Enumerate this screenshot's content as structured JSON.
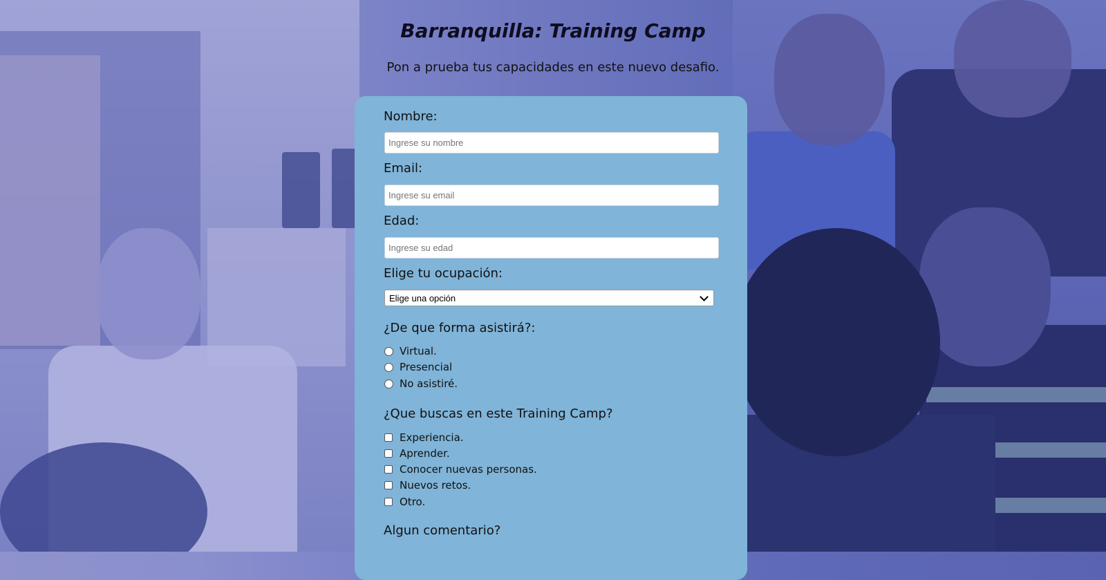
{
  "page": {
    "title": "Barranquilla: Training Camp",
    "subtitle": "Pon a prueba tus capacidades en este nuevo desafio."
  },
  "form": {
    "name_label": "Nombre:",
    "name_placeholder": "Ingrese su nombre",
    "email_label": "Email:",
    "email_placeholder": "Ingrese su email",
    "age_label": "Edad:",
    "age_placeholder": "Ingrese su edad",
    "occupation_label": "Elige tu ocupación:",
    "occupation_selected": "Elige una opción",
    "attendance_label": "¿De que forma asistirá?:",
    "attendance_options": [
      "Virtual.",
      "Presencial",
      "No asistiré."
    ],
    "goals_label": "¿Que buscas en este Training Camp?",
    "goals_options": [
      "Experiencia.",
      "Aprender.",
      "Conocer nuevas personas.",
      "Nuevos retos.",
      "Otro."
    ],
    "comment_label": "Algun comentario?"
  },
  "colors": {
    "card_background": "#80b4d8",
    "page_overlay": "#7f86c9"
  },
  "icons": {
    "select": "chevron-down-icon",
    "radio": "radio-circle",
    "checkbox": "checkbox-square"
  }
}
